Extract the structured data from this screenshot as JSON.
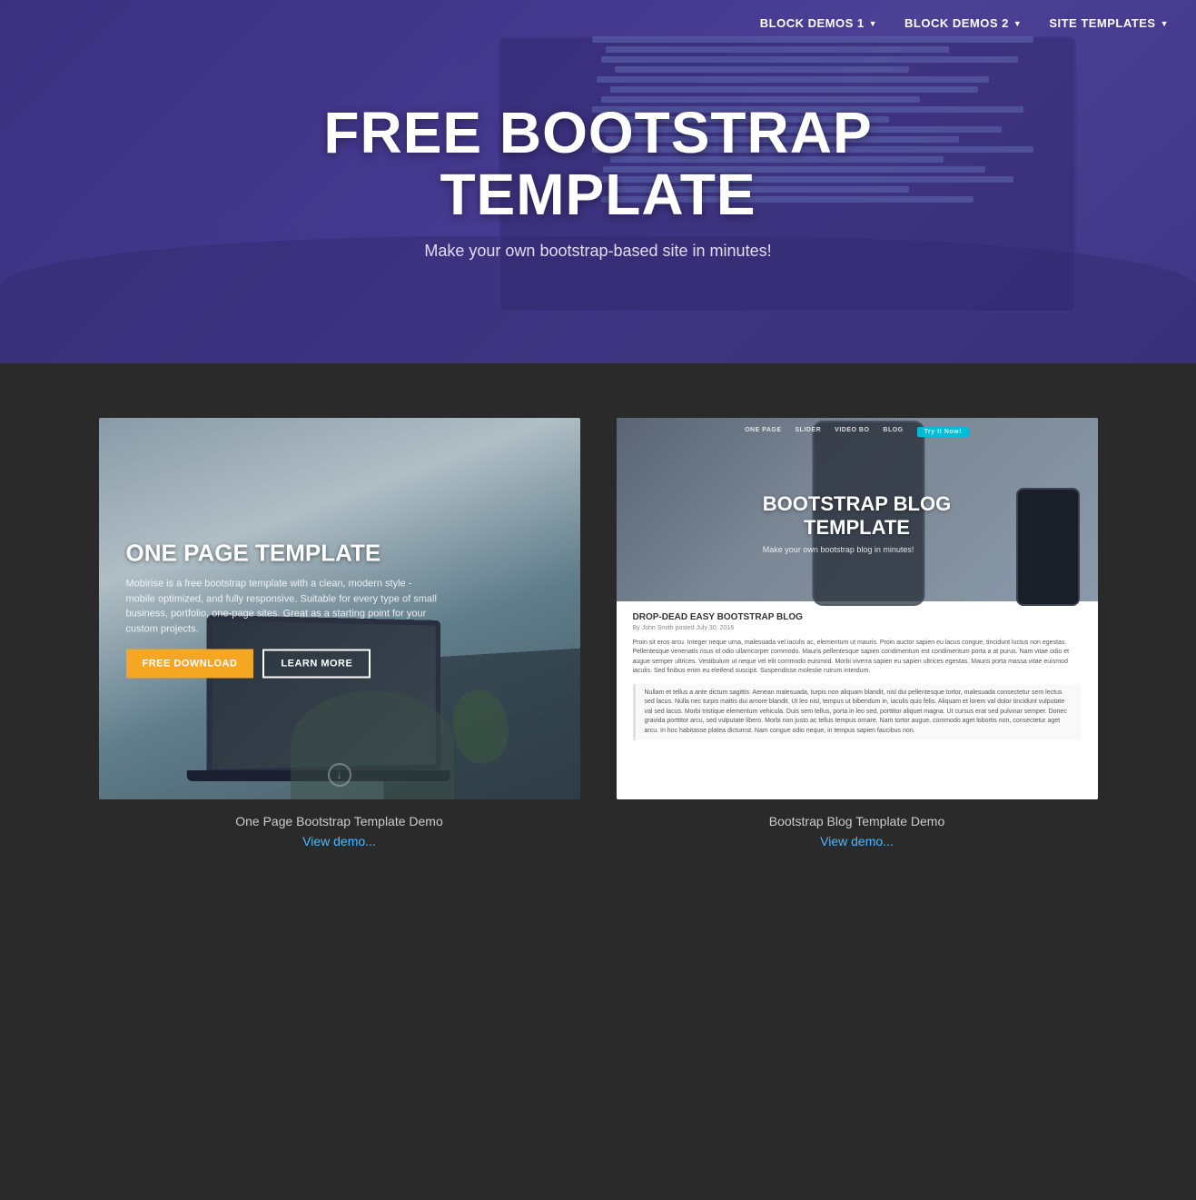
{
  "nav": {
    "items": [
      {
        "id": "block-demos-1",
        "label": "BLOCK DEMOS 1",
        "hasDropdown": true
      },
      {
        "id": "block-demos-2",
        "label": "BLOCK DEMOS 2",
        "hasDropdown": true
      },
      {
        "id": "site-templates",
        "label": "SITE TEMPLATES",
        "hasDropdown": true
      }
    ]
  },
  "hero": {
    "title": "FREE BOOTSTRAP\nTEMPLATE",
    "subtitle": "Make your own bootstrap-based site in minutes!"
  },
  "cards": [
    {
      "id": "one-page-template",
      "preview_type": "one-page",
      "overlay_title": "ONE PAGE TEMPLATE",
      "overlay_desc": "Mobirise is a free bootstrap template with a clean, modern style - mobile optimized, and fully responsive. Suitable for every type of small business, portfolio, one-page sites. Great as a starting point for your custom projects.",
      "btn_primary": "FREE DOWNLOAD",
      "btn_secondary": "LEARN MORE",
      "caption": "One Page Bootstrap Template Demo",
      "view_demo": "View demo..."
    },
    {
      "id": "bootstrap-blog-template",
      "preview_type": "blog",
      "blog_nav_items": [
        "ONE PAGE",
        "SLIDER",
        "VIDEO BO",
        "BLOG"
      ],
      "blog_nav_cta": "Try It Now!",
      "blog_top_title": "BOOTSTRAP BLOG\nTEMPLATE",
      "blog_top_sub": "Make your own bootstrap blog in minutes!",
      "blog_article_title": "DROP-DEAD EASY BOOTSTRAP BLOG",
      "blog_article_meta": "By John Smith posted July 30, 2016",
      "blog_article_text": "Proin sit eros arcu. Integer neque urna, malesuada vel iaculis ac, elementum ut mauris. Proin auctor sapien eu lacus congue, tincidunt luctus non egestas. Pellentesque venenatis risus id odio ullamcorper commodo. Mauris pellentesque sapien condimentum est condimentum porta a at purus. Nam vitae odio et augue semper ultrices. Vestibulum ut neque vel elit commodo euismod. Morbi viverra sapien eu sapien ultrices egestas. Mauris porta massa vitae euismod iaculis. Sed finibus enim eu eleifend suscipit. Suspendisse molestie rutrum interdum.",
      "blog_quote_text": "Nullam et tellus a ante dictum sagittis. Aenean malesuada, turpis non aliquam blandit, nisl dui pellentesque tortor, malesuada consectetur sem lectus sed lacus. Nulla nec turpis mattis dui amore blandit. Ut leo nisl, tempus ut bibendum in, iaculis quis felis. Aliquam et lorem val dolor tincidunt vulputate val sed lacus. Morbi tristique elementum vehicula. Duis sem tellus, porta in leo sed, porttitor aliquet magna. Ut cursus erat sed pulvinar semper. Donec gravida porttitor arcu, sed vulputate libero. Morbi non justo ac tellus tempus ornare. Nam tortor augue, commodo aget lobortis non, consectetur aget arcu. In hoc habitasse platea dictumst. Nam congue odio neque, in tempus sapien faucibus non.",
      "caption": "Bootstrap Blog Template Demo",
      "view_demo": "View demo..."
    }
  ]
}
